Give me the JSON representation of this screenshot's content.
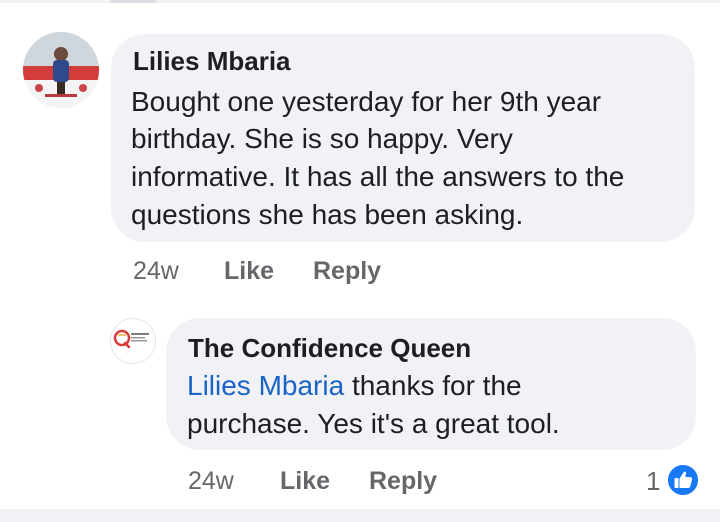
{
  "comments": [
    {
      "author": "Lilies Mbaria",
      "lines": [
        "Bought one yesterday for her 9th year",
        "birthday. She is so happy. Very",
        "informative. It has all the answers to the",
        "questions she has been asking."
      ],
      "time": "24w",
      "like_label": "Like",
      "reply_label": "Reply"
    },
    {
      "author": "The Confidence Queen",
      "mention": "Lilies Mbaria",
      "line1_rest": " thanks for the",
      "line2": "purchase. Yes it's a great tool.",
      "time": "24w",
      "like_label": "Like",
      "reply_label": "Reply",
      "reaction_count": "1",
      "reaction_icon": "thumbs-up-icon",
      "avatar_logo_text": "The Confidence Queen"
    }
  ],
  "colors": {
    "bubble": "#f0f2f5",
    "mention": "#1a64c8",
    "meta": "#65676b",
    "like_blue": "#1877f2"
  }
}
